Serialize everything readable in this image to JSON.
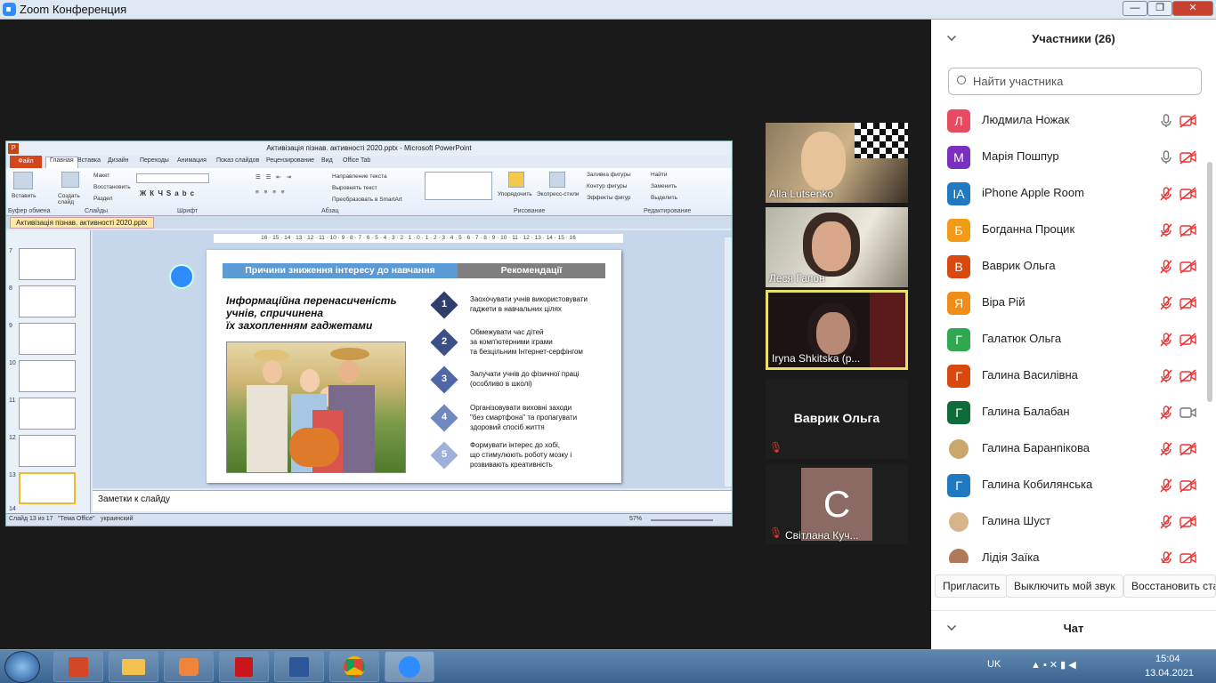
{
  "window": {
    "title": "Zoom Конференция",
    "buttons": {
      "minimize": "—",
      "maximize": "❐",
      "close": "✕"
    }
  },
  "powerpoint": {
    "title": "Активізація пізнав. активності 2020.pptx - Microsoft PowerPoint",
    "file_tab": "Файл",
    "tabs": [
      "Главная",
      "Вставка",
      "Дизайн",
      "Переходы",
      "Анимация",
      "Показ слайдов",
      "Рецензирование",
      "Вид",
      "Office Tab"
    ],
    "groups": [
      "Буфер обмена",
      "Слайды",
      "Шрифт",
      "Абзац",
      "Рисование",
      "Редактирование"
    ],
    "ribbon_buttons": {
      "paste": "Вставить",
      "new_slide": "Создать слайд",
      "layout": "Макет",
      "reset": "Восстановить",
      "section": "Раздел",
      "text_direction": "Направление текста",
      "align_text": "Выровнять текст",
      "smartart": "Преобразовать в SmartArt",
      "arrange": "Упорядочить",
      "quick_styles": "Экспресс-стили",
      "shape_fill": "Заливка фигуры",
      "shape_outline": "Контур фигуры",
      "shape_effects": "Эффекты фигур",
      "find": "Найти",
      "replace": "Заменить",
      "select": "Выделить"
    },
    "doc_tab": "Активізація пізнав. активності 2020.pptx",
    "ruler": "16 · 15 · 14 · 13 · 12 · 11 · 10 · 9 · 8 · 7 · 6 · 5 · 4 · 3 · 2 · 1 · 0 · 1 · 2 · 3 · 4 · 5 · 6 · 7 · 8 · 9 · 10 · 11 · 12 · 13 · 14 · 15 · 16",
    "thumb_numbers": [
      "7",
      "8",
      "9",
      "10",
      "11",
      "12",
      "13",
      "14"
    ],
    "notes_placeholder": "Заметки к слайду",
    "status": {
      "slide": "Слайд 13 из 17",
      "theme": "\"Тема Office\"",
      "language": "украинский",
      "zoom": "57%"
    },
    "slide": {
      "header_left": "Причини зниження інтересу до навчання",
      "header_right": "Рекомендації",
      "headline_lines": [
        "Інформаційна перенасиченість",
        "учнів, спричинена",
        "їх захопленням гаджетами"
      ],
      "recommendations": [
        {
          "num": "1",
          "lines": [
            "Заохочувати учнів використовувати",
            "гаджети в навчальних цілях"
          ],
          "color": "#2f3f6b"
        },
        {
          "num": "2",
          "lines": [
            "Обмежувати час дітей",
            "за комп'ютерними іграми",
            "та безцільним Інтернет-серфінгом"
          ],
          "color": "#3c5088"
        },
        {
          "num": "3",
          "lines": [
            "Залучати учнів до фізичної праці",
            "(особливо в школі)"
          ],
          "color": "#4f67a6"
        },
        {
          "num": "4",
          "lines": [
            "Організовувати виховні заходи",
            "\"без смартфона\" та пропагувати",
            "здоровий спосіб життя"
          ],
          "color": "#7088c0"
        },
        {
          "num": "5",
          "lines": [
            "Формувати інтерес до хобі,",
            "що стимулюють роботу мозку і",
            "розвивають креативність"
          ],
          "color": "#9fb0d9"
        }
      ]
    }
  },
  "video_tiles": [
    {
      "name": "Alla Lutsenko"
    },
    {
      "name": "Леся Гапон"
    },
    {
      "name": "Iryna Shkitska (p..."
    },
    {
      "name": "Ваврик Ольга"
    },
    {
      "name": "Світлана Куч...",
      "initial": "С"
    }
  ],
  "participants_panel": {
    "title": "Участники (26)",
    "search_placeholder": "Найти участника",
    "participants": [
      {
        "name": "Людмила Ножак",
        "initial": "Л",
        "color": "#e84a5f",
        "mic": "on",
        "cam": "off"
      },
      {
        "name": "Марія Пошпур",
        "initial": "М",
        "color": "#7b2fbf",
        "mic": "on",
        "cam": "off"
      },
      {
        "name": "iPhone Apple Room",
        "initial": "IA",
        "color": "#1f7ac2",
        "mic": "off",
        "cam": "off"
      },
      {
        "name": "Богданна Процик",
        "initial": "Б",
        "color": "#f29b16",
        "mic": "off",
        "cam": "off"
      },
      {
        "name": "Ваврик Ольга",
        "initial": "В",
        "color": "#d9480f",
        "mic": "off",
        "cam": "off"
      },
      {
        "name": "Віра Рій",
        "initial": "Я",
        "color": "#f08c18",
        "mic": "off",
        "cam": "off"
      },
      {
        "name": "Галатюк Ольга",
        "initial": "Г",
        "color": "#2fa84f",
        "mic": "off",
        "cam": "off"
      },
      {
        "name": "Галина  Василівна",
        "initial": "Г",
        "color": "#d9480f",
        "mic": "off",
        "cam": "off"
      },
      {
        "name": "Галина Балабан",
        "initial": "Г",
        "color": "#0f6b3a",
        "mic": "off",
        "cam": "on"
      },
      {
        "name": "Галина Баранnікова",
        "initial": "",
        "color": "#c9a66b",
        "mic": "off",
        "cam": "off",
        "photo": true
      },
      {
        "name": "Галина Кобилянська",
        "initial": "Г",
        "color": "#1f7ac2",
        "mic": "off",
        "cam": "off"
      },
      {
        "name": "Галина Шуст",
        "initial": "",
        "color": "#d8b48a",
        "mic": "off",
        "cam": "off",
        "photo": true
      },
      {
        "name": "Лідія Заїка",
        "initial": "",
        "color": "#b07a5a",
        "mic": "off",
        "cam": "off",
        "photo": true
      }
    ],
    "buttons": [
      "Пригласить",
      "Выключить мой звук",
      "Восстановить стат"
    ]
  },
  "chat": {
    "title": "Чат"
  },
  "taskbar": {
    "lang": "UK",
    "time": "15:04",
    "date": "13.04.2021"
  }
}
